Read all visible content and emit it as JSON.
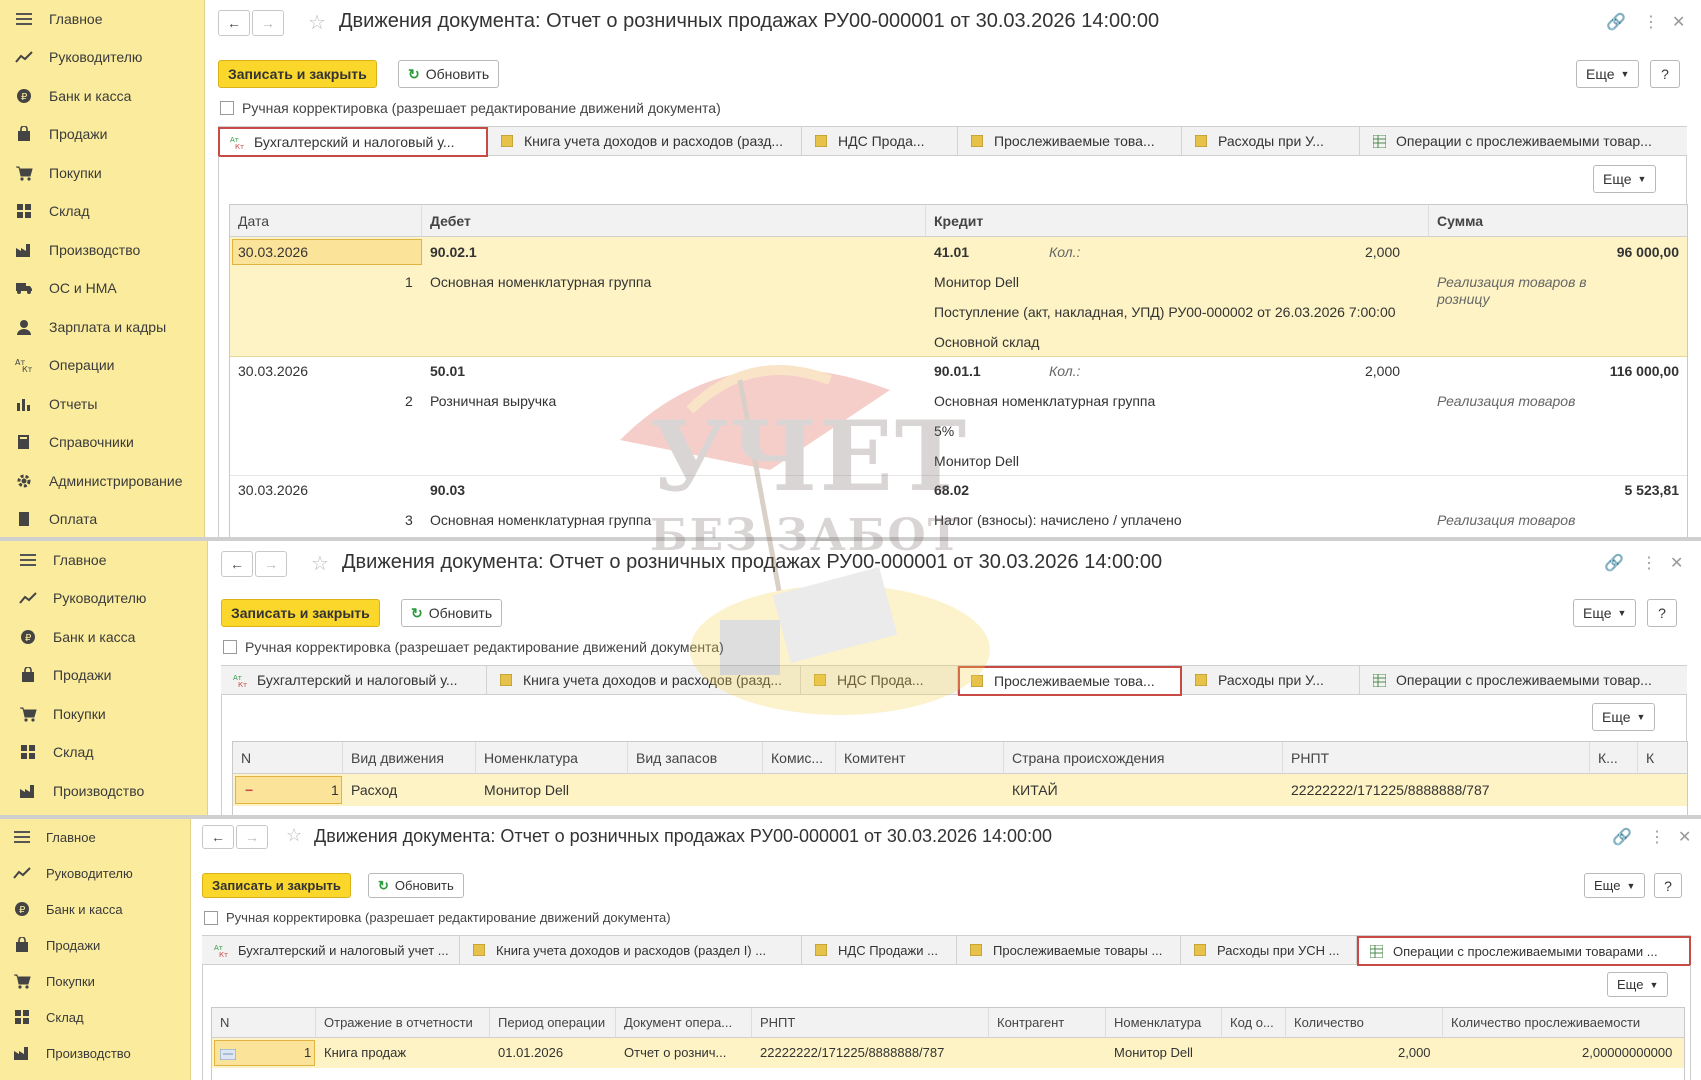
{
  "sidebar": {
    "items": [
      "Главное",
      "Руководителю",
      "Банк и касса",
      "Продажи",
      "Покупки",
      "Склад",
      "Производство",
      "ОС и НМА",
      "Зарплата и кадры",
      "Операции",
      "Отчеты",
      "Справочники",
      "Администрирование",
      "Оплата"
    ]
  },
  "header": {
    "title": "Движения документа: Отчет о розничных продажах РУ00-000001 от 30.03.2026 14:00:00"
  },
  "toolbar": {
    "save_close": "Записать и закрыть",
    "refresh": "Обновить",
    "more": "Еще",
    "help": "?"
  },
  "manual": "Ручная корректировка (разрешает редактирование движений документа)",
  "tabs_short": [
    "Бухгалтерский и налоговый у...",
    "Книга учета доходов и расходов (разд...",
    "НДС Прода...",
    "Прослеживаемые това...",
    "Расходы при У...",
    "Операции с прослеживаемыми товар..."
  ],
  "tabs_long": [
    "Бухгалтерский и налоговый учет ...",
    "Книга учета доходов и расходов (раздел I) ...",
    "НДС Продажи ...",
    "Прослеживаемые товары ...",
    "Расходы при УСН ...",
    "Операции с прослеживаемыми товарами ..."
  ],
  "grid1": {
    "headers": [
      "Дата",
      "Дебет",
      "Кредит",
      "Сумма"
    ],
    "rows": [
      {
        "date": "30.03.2026",
        "num": "1",
        "debit_acc": "90.02.1",
        "debit_sub": [
          "Основная номенклатурная группа"
        ],
        "credit_acc": "41.01",
        "qty_label": "Кол.:",
        "qty": "2,000",
        "credit_sub": [
          "Монитор Dell",
          "Поступление (акт, накладная, УПД) РУ00-000002 от 26.03.2026 7:00:00",
          "Основной склад"
        ],
        "sum": "96 000,00",
        "comment": "Реализация товаров в розницу"
      },
      {
        "date": "30.03.2026",
        "num": "2",
        "debit_acc": "50.01",
        "debit_sub": [
          "Розничная выручка"
        ],
        "credit_acc": "90.01.1",
        "qty_label": "Кол.:",
        "qty": "2,000",
        "credit_sub": [
          "Основная номенклатурная группа",
          "5%",
          "Монитор Dell"
        ],
        "sum": "116 000,00",
        "comment": "Реализация товаров"
      },
      {
        "date": "30.03.2026",
        "num": "3",
        "debit_acc": "90.03",
        "debit_sub": [
          "Основная номенклатурная группа"
        ],
        "credit_acc": "68.02",
        "qty_label": "",
        "qty": "",
        "credit_sub": [
          "Налог (взносы): начислено / уплачено"
        ],
        "sum": "5 523,81",
        "comment": "Реализация товаров"
      }
    ]
  },
  "grid2": {
    "headers": [
      "N",
      "Вид движения",
      "Номенклатура",
      "Вид запасов",
      "Комис...",
      "Комитент",
      "Страна происхождения",
      "РНПТ",
      "К...",
      "К"
    ],
    "row": {
      "sign": "−",
      "n": "1",
      "movement": "Расход",
      "item": "Монитор Dell",
      "stock": "",
      "komis": "",
      "komitent": "",
      "country": "КИТАЙ",
      "rnpt": "22222222/171225/8888888/787"
    }
  },
  "grid3": {
    "headers": [
      "N",
      "Отражение в отчетности",
      "Период операции",
      "Документ опера...",
      "РНПТ",
      "Контрагент",
      "Номенклатура",
      "Код о...",
      "Количество",
      "Количество прослеживаемости"
    ],
    "row": {
      "n": "1",
      "reflect": "Книга продаж",
      "period": "01.01.2026",
      "doc": "Отчет о рознич...",
      "rnpt": "22222222/171225/8888888/787",
      "contractor": "",
      "item": "Монитор Dell",
      "code": "",
      "qty": "2,000",
      "qty_trace": "2,00000000000"
    }
  },
  "watermark": {
    "line1": "УЧЕТ",
    "line2": "БЕЗ ЗАБОТ"
  }
}
